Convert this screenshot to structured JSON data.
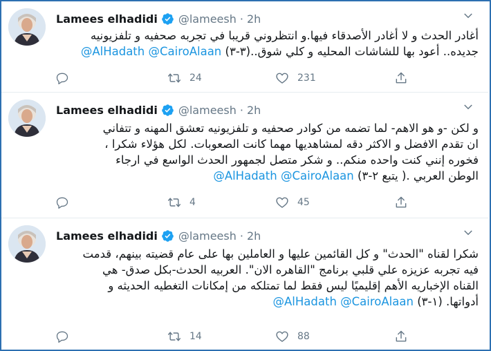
{
  "tweets": [
    {
      "name": "Lamees elhadidi",
      "handle": "@lameesh",
      "time": "2h",
      "lines": [
        {
          "text": "أغادر الحدث و لا أغادر الأصدقاء فيها.و انتظروني قريبا في تجربه صحفيه و تلفزيونيه"
        },
        {
          "text": "جديده.. أعود بها للشاشات المحليه و كلي شوق..(٣-٣)",
          "mentions": "@AlHadath @CairoAlaan"
        }
      ],
      "reply_count": "",
      "retweet_count": "24",
      "like_count": "231"
    },
    {
      "name": "Lamees elhadidi",
      "handle": "@lameesh",
      "time": "2h",
      "lines": [
        {
          "text": "و لكن -و هو الاهم- لما تضمه من كوادر صحفيه و تلفزيونيه تعشق المهنه و تتفاني"
        },
        {
          "text": "ان تقدم الافضل و الاكثر دقه لمشاهديها مهما كانت الصعوبات. لكل هؤلاء شكرا ،"
        },
        {
          "text": "فخوره إنني كنت واحده منكم..  و شكر متصل لجمهور الحدث  الواسع  في ارجاء"
        },
        {
          "text": "الوطن العربي .( يتبع ٢-٣)",
          "mentions": "@AlHadath @CairoAlaan"
        }
      ],
      "reply_count": "",
      "retweet_count": "4",
      "like_count": "45"
    },
    {
      "name": "Lamees elhadidi",
      "handle": "@lameesh",
      "time": "2h",
      "lines": [
        {
          "text": "شكرا لقناه \"الحدث\" و كل القائمين عليها و العاملين بها على عام قضيته بينهم، قدمت"
        },
        {
          "text": "فيه تجربه عزيزه علي قلبي برنامج \"القاهره الان\". العربيه الحدث-بكل صدق- هي"
        },
        {
          "text": "القناه الإخباريه الأهم إقليميًا ليس فقط لما تمتلكه من إمكانات التغطيه الحديثه و"
        },
        {
          "text": "أدواتها. (١-٣)",
          "mentions": "@AlHadath @CairoAlaan"
        }
      ],
      "reply_count": "",
      "retweet_count": "14",
      "like_count": "88"
    }
  ],
  "icons": {
    "verified": "verified-badge-icon",
    "chevron": "chevron-down-icon",
    "reply": "reply-icon",
    "retweet": "retweet-icon",
    "like": "heart-icon",
    "share": "share-icon"
  },
  "colors": {
    "accent": "#1b95e0",
    "verified": "#1da1f2",
    "muted": "#657786",
    "text": "#14171a"
  }
}
